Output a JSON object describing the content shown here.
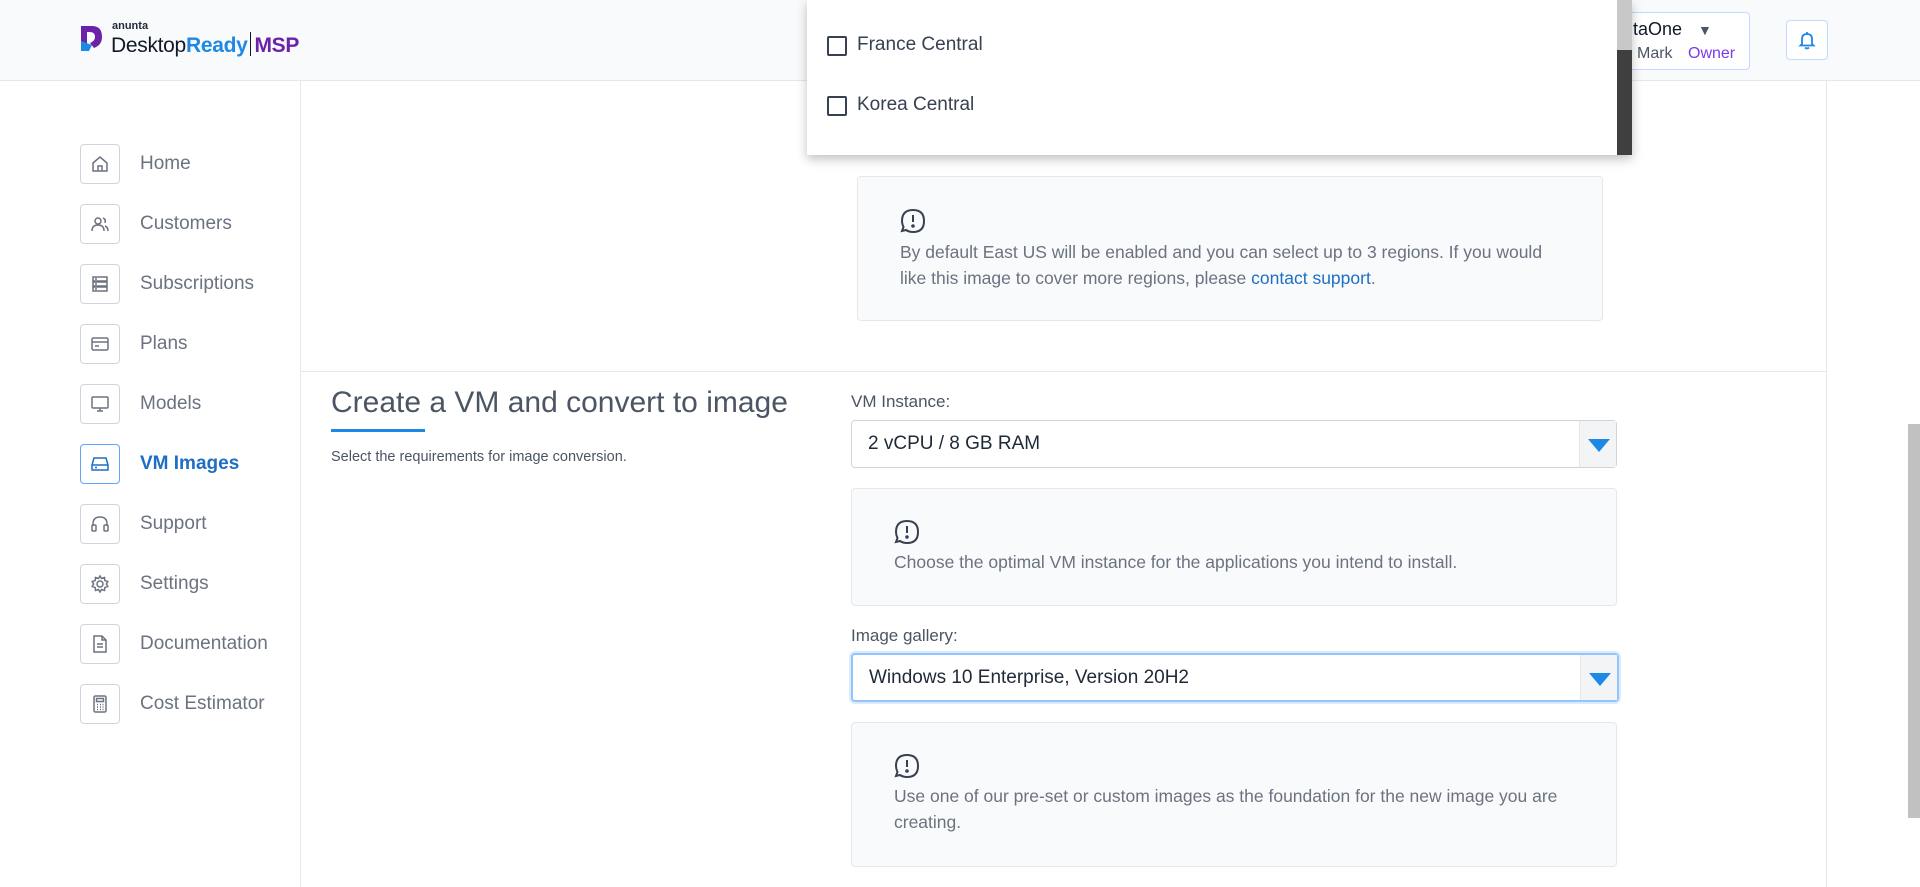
{
  "header": {
    "logo": {
      "anunta": "anunta",
      "desktop": "Desktop",
      "ready": "Ready",
      "msp": "MSP"
    },
    "user": {
      "name": "ntaOne",
      "mark": "Mark",
      "role": "Owner"
    }
  },
  "sidebar": {
    "items": [
      {
        "label": "Home",
        "icon": "home-icon"
      },
      {
        "label": "Customers",
        "icon": "users-icon"
      },
      {
        "label": "Subscriptions",
        "icon": "server-icon"
      },
      {
        "label": "Plans",
        "icon": "card-icon"
      },
      {
        "label": "Models",
        "icon": "monitor-icon"
      },
      {
        "label": "VM Images",
        "icon": "disk-icon",
        "active": true
      },
      {
        "label": "Support",
        "icon": "headset-icon"
      },
      {
        "label": "Settings",
        "icon": "gear-icon"
      },
      {
        "label": "Documentation",
        "icon": "document-icon"
      },
      {
        "label": "Cost Estimator",
        "icon": "calculator-icon"
      }
    ]
  },
  "regions_dropdown": {
    "options": [
      {
        "label": "France Central",
        "checked": false
      },
      {
        "label": "Korea Central",
        "checked": false
      }
    ]
  },
  "regions_info": {
    "text": "By default East US will be enabled and you can select up to 3 regions. If you would like this image to cover more regions, please",
    "link": "contact support",
    "suffix": "."
  },
  "vm_section": {
    "title": "Create a VM and convert to image",
    "subtitle": "Select the requirements for image conversion.",
    "vm_instance": {
      "label": "VM Instance:",
      "value": "2 vCPU / 8 GB RAM",
      "info": "Choose the optimal VM instance for the applications you intend to install."
    },
    "image_gallery": {
      "label": "Image gallery:",
      "value": "Windows 10 Enterprise, Version 20H2",
      "info": "Use one of our pre-set or custom images as the foundation for the new image you are creating."
    }
  },
  "colors": {
    "accent": "#1e88e5",
    "brand_purple": "#6b21a8",
    "link": "#1e6fc4"
  }
}
